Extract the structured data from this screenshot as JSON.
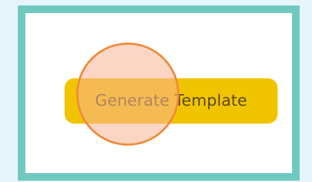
{
  "button": {
    "label": "Generate Template",
    "color": "#f1c400"
  },
  "frame": {
    "border_color": "#6fc9bf"
  },
  "tap_marker": {
    "color": "#f08a3a"
  }
}
